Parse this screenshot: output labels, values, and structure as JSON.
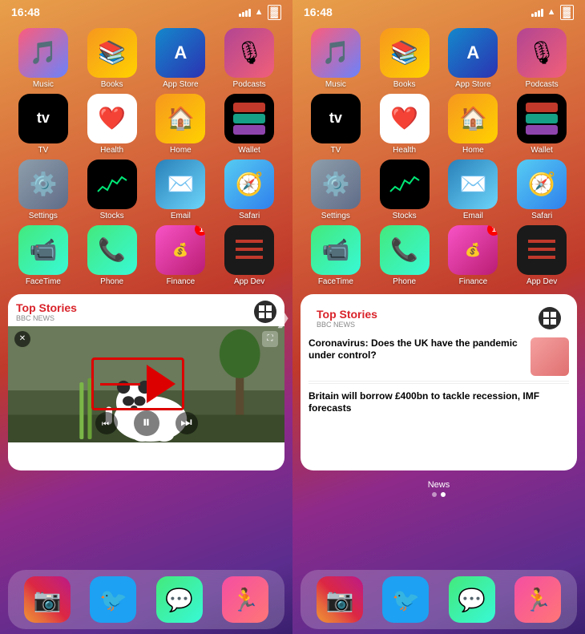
{
  "panels": [
    {
      "id": "left",
      "status": {
        "time": "16:48",
        "signal": "signal",
        "wifi": "wifi",
        "battery": "battery"
      },
      "apps": [
        {
          "id": "music",
          "icon": "music",
          "label": "Music",
          "iconClass": "icon-music",
          "glyph": "♪"
        },
        {
          "id": "books",
          "icon": "books",
          "label": "Books",
          "iconClass": "icon-books",
          "glyph": "📖"
        },
        {
          "id": "appstore",
          "icon": "appstore",
          "label": "App Store",
          "iconClass": "icon-appstore",
          "glyph": "A"
        },
        {
          "id": "podcasts",
          "icon": "podcasts",
          "label": "Podcasts",
          "iconClass": "icon-podcasts",
          "glyph": "🎙"
        },
        {
          "id": "tv",
          "icon": "tv",
          "label": "TV",
          "iconClass": "icon-tv",
          "glyph": "📺"
        },
        {
          "id": "health",
          "icon": "health",
          "label": "Health",
          "iconClass": "icon-health",
          "glyph": "❤️"
        },
        {
          "id": "home",
          "icon": "home",
          "label": "Home",
          "iconClass": "icon-home",
          "glyph": "🏠"
        },
        {
          "id": "wallet",
          "icon": "wallet",
          "label": "Wallet",
          "iconClass": "icon-wallet",
          "glyph": "💳"
        },
        {
          "id": "settings",
          "icon": "settings",
          "label": "Settings",
          "iconClass": "icon-settings",
          "glyph": "⚙️"
        },
        {
          "id": "stocks",
          "icon": "stocks",
          "label": "Stocks",
          "iconClass": "icon-stocks",
          "glyph": "📈"
        },
        {
          "id": "email",
          "icon": "email",
          "label": "Email",
          "iconClass": "icon-email",
          "glyph": "✉️"
        },
        {
          "id": "safari",
          "icon": "safari",
          "label": "Safari",
          "iconClass": "icon-safari",
          "glyph": "🧭"
        },
        {
          "id": "facetime",
          "icon": "facetime",
          "label": "FaceTime",
          "iconClass": "icon-facetime",
          "glyph": "📹"
        },
        {
          "id": "phone",
          "icon": "phone",
          "label": "Phone",
          "iconClass": "icon-phone",
          "glyph": "📞"
        },
        {
          "id": "finance",
          "icon": "finance",
          "label": "Finance",
          "iconClass": "icon-finance",
          "glyph": "💰",
          "badge": "1"
        },
        {
          "id": "appdev",
          "icon": "appdev",
          "label": "App Dev",
          "iconClass": "icon-appdev",
          "glyph": "///"
        }
      ],
      "widget": {
        "type": "news-video",
        "header": {
          "topStories": "Top Stories",
          "source": "BBC NEWS"
        }
      },
      "dock": [
        {
          "id": "instagram",
          "iconClass": "icon-instagram",
          "label": "Instagram",
          "glyph": "📷"
        },
        {
          "id": "twitter",
          "iconClass": "icon-twitter",
          "label": "Twitter",
          "glyph": "🐦"
        },
        {
          "id": "messages",
          "iconClass": "icon-messages",
          "label": "Messages",
          "glyph": "💬"
        },
        {
          "id": "fitness",
          "iconClass": "icon-fitness",
          "label": "Fitness",
          "glyph": "🏃"
        }
      ]
    },
    {
      "id": "right",
      "status": {
        "time": "16:48"
      },
      "apps": [
        {
          "id": "music2",
          "label": "Music",
          "iconClass": "icon-music",
          "glyph": "♪"
        },
        {
          "id": "books2",
          "label": "Books",
          "iconClass": "icon-books",
          "glyph": "📖"
        },
        {
          "id": "appstore2",
          "label": "App Store",
          "iconClass": "icon-appstore",
          "glyph": "A"
        },
        {
          "id": "podcasts2",
          "label": "Podcasts",
          "iconClass": "icon-podcasts",
          "glyph": "🎙"
        },
        {
          "id": "tv2",
          "label": "TV",
          "iconClass": "icon-tv",
          "glyph": "📺"
        },
        {
          "id": "health2",
          "label": "Health",
          "iconClass": "icon-health",
          "glyph": "❤️"
        },
        {
          "id": "home2",
          "label": "Home",
          "iconClass": "icon-home",
          "glyph": "🏠"
        },
        {
          "id": "wallet2",
          "label": "Wallet",
          "iconClass": "icon-wallet",
          "glyph": "💳"
        },
        {
          "id": "settings2",
          "label": "Settings",
          "iconClass": "icon-settings",
          "glyph": "⚙️"
        },
        {
          "id": "stocks2",
          "label": "Stocks",
          "iconClass": "icon-stocks",
          "glyph": "📈"
        },
        {
          "id": "email2",
          "label": "Email",
          "iconClass": "icon-email",
          "glyph": "✉️"
        },
        {
          "id": "safari2",
          "label": "Safari",
          "iconClass": "icon-safari",
          "glyph": "🧭"
        },
        {
          "id": "facetime2",
          "label": "FaceTime",
          "iconClass": "icon-facetime",
          "glyph": "📹"
        },
        {
          "id": "phone2",
          "label": "Phone",
          "iconClass": "icon-phone",
          "glyph": "📞"
        },
        {
          "id": "finance2",
          "label": "Finance",
          "iconClass": "icon-finance",
          "glyph": "💰",
          "badge": "1"
        },
        {
          "id": "appdev2",
          "label": "App Dev",
          "iconClass": "icon-appdev",
          "glyph": "///"
        }
      ],
      "widget": {
        "type": "news-articles",
        "header": {
          "topStories": "Top Stories",
          "source": "BBC NEWS"
        },
        "articles": [
          {
            "headline": "Coronavirus: Does the UK have the pandemic under control?",
            "hasThumb": true
          },
          {
            "headline": "Britain will borrow £400bn to tackle recession, IMF forecasts",
            "hasThumb": false
          }
        ]
      },
      "widgetLabel": "News",
      "dots": [
        false,
        true
      ],
      "dock": [
        {
          "id": "instagram2",
          "iconClass": "icon-instagram",
          "label": "Instagram",
          "glyph": "📷"
        },
        {
          "id": "twitter2",
          "iconClass": "icon-twitter",
          "label": "Twitter",
          "glyph": "🐦"
        },
        {
          "id": "messages2",
          "iconClass": "icon-messages",
          "label": "Messages",
          "glyph": "💬"
        },
        {
          "id": "fitness2",
          "iconClass": "icon-fitness",
          "label": "Fitness",
          "glyph": "🏃"
        }
      ]
    }
  ],
  "icons": {
    "close": "✕",
    "expand": "⛶",
    "rewind": "⏮",
    "pause": "⏸",
    "forward": "⏭",
    "news": "◩",
    "chevron": "❯"
  }
}
